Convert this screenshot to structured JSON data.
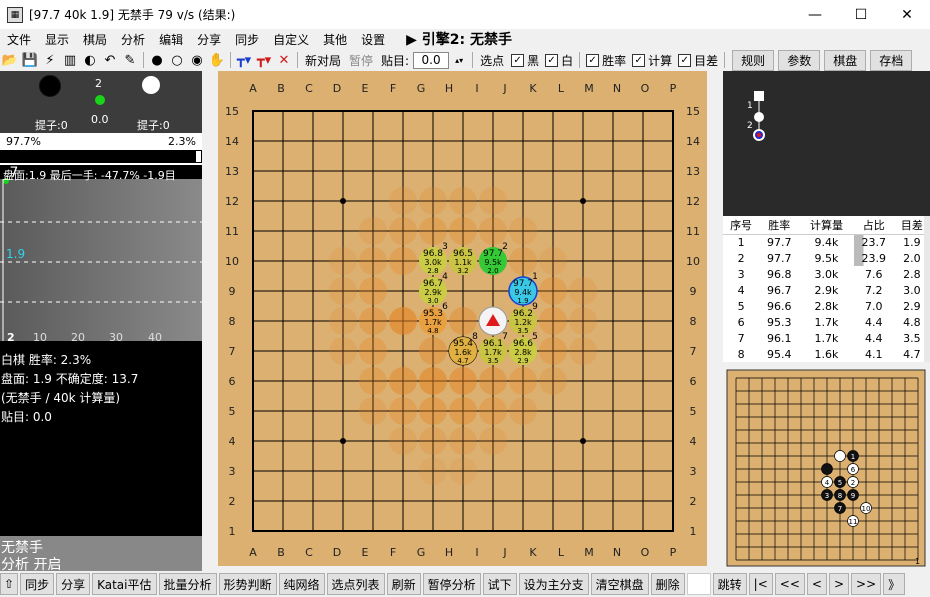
{
  "window": {
    "title": "[97.7 40k 1.9] 无禁手 79 v/s (结果:)",
    "minimize": "—",
    "maximize": "☐",
    "close": "✕"
  },
  "menu": {
    "items": [
      "文件",
      "显示",
      "棋局",
      "分析",
      "编辑",
      "分享",
      "同步",
      "自定义",
      "其他",
      "设置"
    ],
    "engine": "▶ 引擎2: 无禁手"
  },
  "toolbar": {
    "new_game": "新对局",
    "pause": "暂停",
    "komi_label": "贴目:",
    "komi_value": "0.0",
    "select_point": "选点",
    "chk_black": "黑",
    "chk_white": "白",
    "chk_winrate": "胜率",
    "chk_playouts": "计算",
    "chk_score": "目差",
    "btn_rules": "规则",
    "btn_params": "参数",
    "btn_board": "棋盘",
    "btn_save": "存档"
  },
  "left": {
    "move_number": "2",
    "last_move_value": "0.0",
    "black_captures": "提子:0",
    "white_captures": "提子:0",
    "black_winrate": "97.7%",
    "white_winrate": "2.3%",
    "winrate_fraction": 0.977,
    "score_line": "盘面:1.9 最后一手: -47.7% -1.9目",
    "graph_top_value": ".7",
    "graph_score_value": "1.9",
    "graph_move": "2",
    "graph_ticks": [
      "10",
      "20",
      "30",
      "40"
    ],
    "info_line1": "白棋 胜率: 2.3%",
    "info_line2": "盘面: 1.9 不确定度: 13.7",
    "info_line3": "(无禁手 / 40k 计算量)",
    "info_line4": "贴目: 0.0",
    "engine_label": "无禁手",
    "analysis_label": "分析 开启"
  },
  "board": {
    "cols": [
      "A",
      "B",
      "C",
      "D",
      "E",
      "F",
      "G",
      "H",
      "I",
      "J",
      "K",
      "L",
      "M",
      "N",
      "O",
      "P"
    ],
    "rows": [
      "15",
      "14",
      "13",
      "12",
      "11",
      "10",
      "9",
      "8",
      "7",
      "6",
      "5",
      "4",
      "3",
      "2",
      "1"
    ],
    "candidates": [
      {
        "wr": "96.8",
        "po": "3.0k",
        "sc": "2.8",
        "rank": "3"
      },
      {
        "wr": "96.5",
        "po": "1.1k",
        "sc": "3.2",
        "rank": ""
      },
      {
        "wr": "97.7",
        "po": "9.5k",
        "sc": "2.0",
        "rank": "2"
      },
      {
        "wr": "96.7",
        "po": "2.9k",
        "sc": "3.0",
        "rank": "4"
      },
      {
        "wr": "97.7",
        "po": "9.4k",
        "sc": "1.9",
        "rank": "1"
      },
      {
        "wr": "95.3",
        "po": "1.7k",
        "sc": "4.8",
        "rank": "6"
      },
      {
        "wr": "96.2",
        "po": "1.2k",
        "sc": "3.5",
        "rank": "9"
      },
      {
        "wr": "95.4",
        "po": "1.6k",
        "sc": "4.7",
        "rank": "8"
      },
      {
        "wr": "96.1",
        "po": "1.7k",
        "sc": "3.5",
        "rank": "7"
      },
      {
        "wr": "96.6",
        "po": "2.8k",
        "sc": "2.9",
        "rank": "5"
      }
    ]
  },
  "tree": {
    "node1": "1",
    "node2": "2"
  },
  "table": {
    "headers": [
      "序号",
      "胜率",
      "计算量",
      "占比",
      "目差"
    ],
    "rows": [
      [
        "1",
        "97.7",
        "9.4k",
        "23.7",
        "1.9"
      ],
      [
        "2",
        "97.7",
        "9.5k",
        "23.9",
        "2.0"
      ],
      [
        "3",
        "96.8",
        "3.0k",
        "7.6",
        "2.8"
      ],
      [
        "4",
        "96.7",
        "2.9k",
        "7.2",
        "3.0"
      ],
      [
        "5",
        "96.6",
        "2.8k",
        "7.0",
        "2.9"
      ],
      [
        "6",
        "95.3",
        "1.7k",
        "4.4",
        "4.8"
      ],
      [
        "7",
        "96.1",
        "1.7k",
        "4.4",
        "3.5"
      ],
      [
        "8",
        "95.4",
        "1.6k",
        "4.1",
        "4.7"
      ]
    ]
  },
  "mini": {
    "labels": [
      "1",
      "4",
      "5",
      "6",
      "2",
      "3",
      "7",
      "9",
      "8",
      "10",
      "11"
    ],
    "corner": "1"
  },
  "bottom": {
    "buttons": [
      "同步",
      "分享",
      "Katai平估",
      "批量分析",
      "形势判断",
      "纯网络",
      "选点列表",
      "刷新",
      "暂停分析",
      "试下",
      "设为主分支",
      "清空棋盘",
      "删除"
    ],
    "jump": "跳转",
    "nav": [
      "|<",
      "<<",
      "<",
      ">",
      ">>",
      "》"
    ]
  }
}
